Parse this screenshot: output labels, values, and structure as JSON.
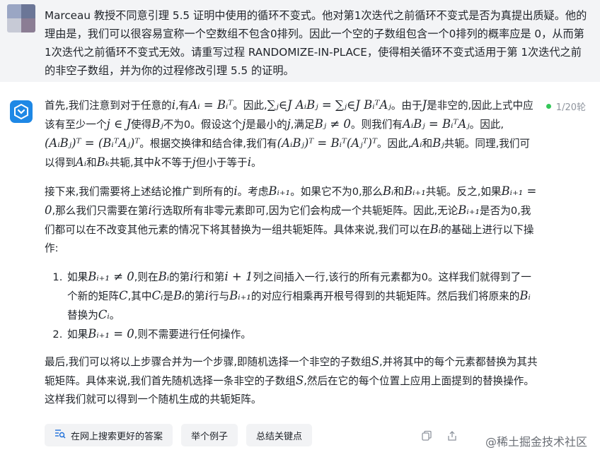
{
  "question": {
    "text": "Marceau 教授不同意引理 5.5 证明中使用的循环不变式。他对第1次迭代之前循环不变式是否为真提出质疑。他的理由是，我们可以很容易宣称一个空数组不包含0排列。因此一个空的子数组包含一个0排列的概率应是 0，从而第 1次迭代之前循环不变式无效。请重写过程 RANDOMIZE-IN-PLACE，使得相关循环不变式适用于第 1次迭代之前的非空子数组，并为你的过程修改引理 5.5 的证明。"
  },
  "status": {
    "rounds": "1/20轮",
    "dot_color": "#34c759"
  },
  "answer": {
    "p1": [
      "首先,我们注意到对于任意的",
      "i",
      ",有",
      "Aᵢ = Bᵢᵀ",
      "。因此,",
      "∑ⱼ∈J AᵢBⱼ = ∑ⱼ∈J BᵢᵀAⱼ",
      "。由于",
      "J",
      "是非空的,因此上式中应该有至少一个",
      "j ∈ J",
      "使得",
      "Bⱼ",
      "不为0。假设这个",
      "j",
      "是最小的",
      "j",
      ",满足",
      "Bⱼ ≠ 0",
      "。则我们有",
      "AᵢBⱼ = BᵢᵀAⱼ",
      "。因此,",
      "(AᵢBⱼ)ᵀ = (BᵢᵀAⱼ)ᵀ",
      "。根据交换律和结合律,我们有",
      "(AᵢBⱼ)ᵀ = Bᵢᵀ(Aⱼᵀ)ᵀ",
      "。因此,",
      "Aᵢ",
      "和",
      "Bⱼ",
      "共轭。同理,我们可以得到",
      "Aᵢ",
      "和",
      "Bₖ",
      "共轭,其中",
      "k",
      "不等于",
      "j",
      "但小于等于",
      "i",
      "。"
    ],
    "p2": [
      "接下来,我们需要将上述结论推广到所有的",
      "i",
      "。考虑",
      "Bᵢ₊₁",
      "。如果它不为0,那么",
      "Bᵢ",
      "和",
      "Bᵢ₊₁",
      "共轭。反之,如果",
      "Bᵢ₊₁ = 0",
      ",那么我们只需要在第",
      "i",
      "行选取所有非零元素即可,因为它们会构成一个共轭矩阵。因此,无论",
      "Bᵢ₊₁",
      "是否为0,我们都可以在不改变其他元素的情况下将其替换为一组共轭矩阵。具体来说,我们可以在",
      "Bᵢ",
      "的基础上进行以下操作:"
    ],
    "li1": [
      "如果",
      "Bᵢ₊₁ ≠ 0",
      ",则在",
      "Bᵢ",
      "的第",
      "i",
      "行和第",
      "i + 1",
      "列之间插入一行,该行的所有元素都为0。这样我们就得到了一个新的矩阵",
      "C",
      ",其中",
      "Cᵢ",
      "是",
      "Bᵢ",
      "的第",
      "i",
      "行与",
      "Bᵢ₊₁",
      "的对应行相乘再开根号得到的共轭矩阵。然后我们将原来的",
      "Bᵢ",
      "替换为",
      "Cᵢ",
      "。"
    ],
    "li2": [
      "如果",
      "Bᵢ₊₁ = 0",
      ",则不需要进行任何操作。"
    ],
    "p3": [
      "最后,我们可以将以上步骤合并为一个步骤,即随机选择一个非空的子数组",
      "S",
      ",并将其中的每个元素都替换为其共轭矩阵。具体来说,我们首先随机选择一条非空的子数组",
      "S",
      ",然后在它的每个位置上应用上面提到的替换操作。这样我们就可以得到一个随机生成的共轭矩阵。"
    ]
  },
  "actions": {
    "search": "在网上搜索更好的答案",
    "example": "举个例子",
    "summary": "总结关键点"
  },
  "watermark": {
    "text": "@稀土掘金技术社区"
  },
  "icons": {
    "bot": "chat-bot-icon",
    "search": "search-list-icon",
    "copy": "copy-icon",
    "share": "share-icon"
  },
  "colors": {
    "accent": "#1e88e5",
    "question_bg": "#f3f4f6",
    "chip_bg": "#f2f3f5"
  }
}
